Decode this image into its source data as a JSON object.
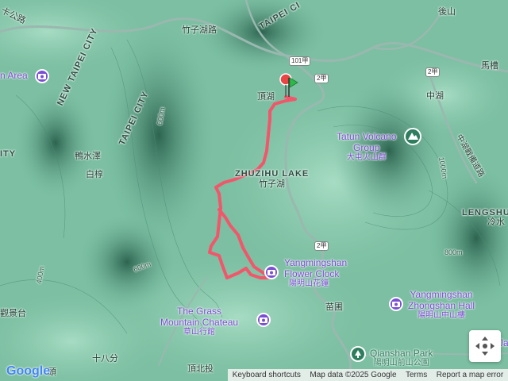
{
  "roads": {
    "zhuzihu_road": "竹子湖路",
    "taipei_city_top": "TAIPEI CI",
    "road_tl": "卡公路",
    "road_tr": "後山",
    "highway_101a": "101甲",
    "highway_2a_top": "2甲",
    "highway_2a_right": "2甲",
    "highway_2a_bottom": "2甲",
    "yangjin_road": "中湖戰備道路"
  },
  "places": {
    "dinghu": "頂湖",
    "zhonghu": "中湖",
    "machao": "馬槽",
    "yashuize": "鴨水澤",
    "baiguo": "白椁",
    "shibafen": "十八分",
    "dingbeitou": "頂北投",
    "miaopu": "苗圃",
    "zhuzihu_zh": "竹子湖",
    "guanjingtai": "觀景台",
    "lengshuikeng_zh": "冷水",
    "left_partial_1": "n Area",
    "left_partial_2": "ITY",
    "left_bottom_zh": "頭",
    "right_edge": "Ja"
  },
  "regions": {
    "new_taipei_city": "NEW TAIPEI CITY",
    "taipei_city": "TAIPEI CITY",
    "zhuzihu_lake": "ZHUZIHU LAKE",
    "lengshui": "LENGSHU"
  },
  "pois": {
    "tatun": {
      "line1": "Tatun Volcano",
      "line2": "Group",
      "zh": "大屯火山群"
    },
    "flower_clock": {
      "line1": "Yangmingshan",
      "line2": "Flower Clock",
      "zh": "陽明山花鐘"
    },
    "grass_mountain": {
      "line1": "The Grass",
      "line2": "Mountain Chateau",
      "zh": "草山行館"
    },
    "zhongshan_hall": {
      "line1": "Yangmingshan",
      "line2": "Zhongshan Hall",
      "zh": "陽明山中山樓"
    },
    "qianshan_park": {
      "line1": "Qianshan Park",
      "zh": "陽明山前山公園"
    }
  },
  "contours": {
    "c600_left": "600m",
    "c600_mid": "600m",
    "c800_right": "800m",
    "c1000": "1000m",
    "c400": "400m"
  },
  "footer": {
    "shortcuts": "Keyboard shortcuts",
    "map_data": "Map data ©2025 Google",
    "terms": "Terms",
    "report": "Report a map error"
  },
  "logo": "Google",
  "colors": {
    "track": "#f2566a",
    "poi": "#7b4fd3",
    "terrain_low": "#8fcbb0",
    "terrain_high": "#2f6b55"
  }
}
